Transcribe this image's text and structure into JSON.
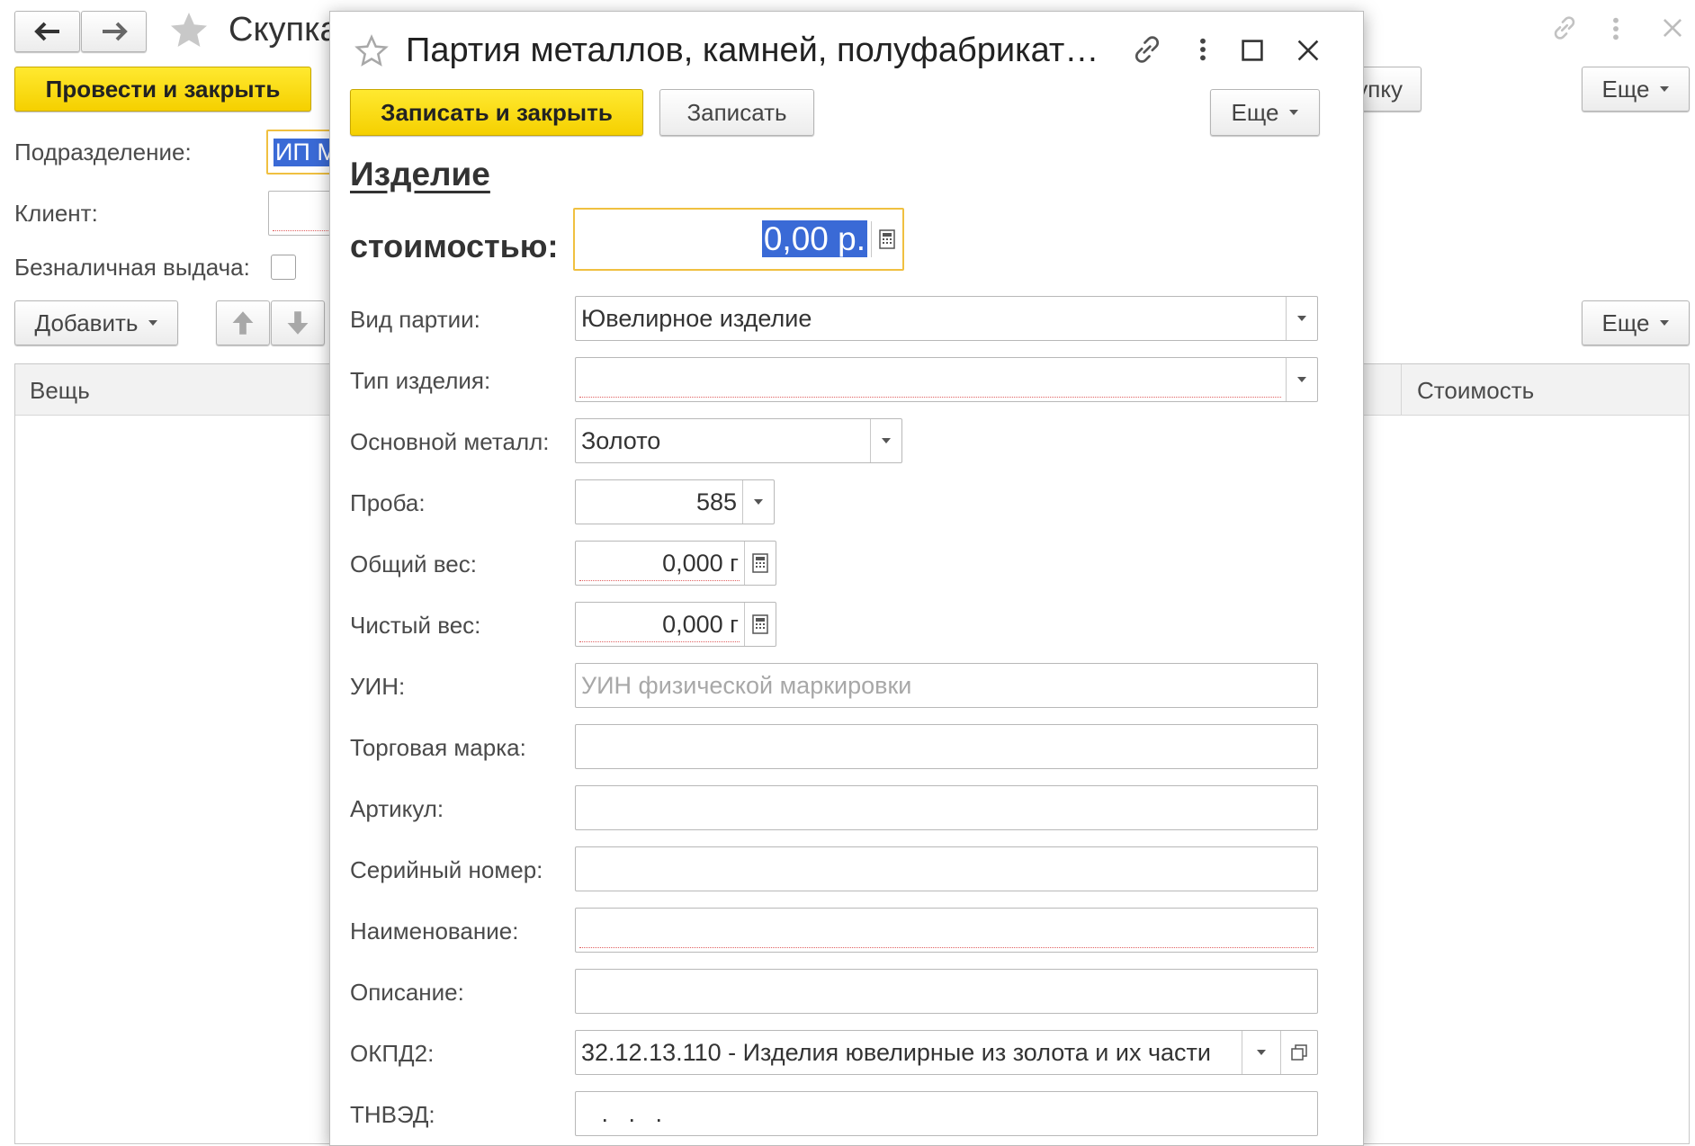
{
  "background": {
    "title": "Скупка",
    "post_close_label": "Провести и закрыть",
    "more_label": "Еще",
    "right_button_label": "упку",
    "fields": {
      "division_label": "Подразделение:",
      "division_value": "ИП М",
      "client_label": "Клиент:",
      "cashless_label": "Безналичная выдача:"
    },
    "add_label": "Добавить",
    "table_more_label": "Еще",
    "columns": {
      "item": "Вещь",
      "cost": "Стоимость"
    }
  },
  "modal": {
    "title": "Партия металлов, камней, полуфабрикат…",
    "save_close_label": "Записать и закрыть",
    "save_label": "Записать",
    "more_label": "Еще",
    "section_title": "Изделие",
    "cost_label": "стоимостью:",
    "cost_value": "0,00 р.",
    "rows": {
      "batch_type": {
        "label": "Вид партии:",
        "value": "Ювелирное изделие"
      },
      "item_type": {
        "label": "Тип изделия:",
        "value": ""
      },
      "main_metal": {
        "label": "Основной металл:",
        "value": "Золото"
      },
      "fineness": {
        "label": "Проба:",
        "value": "585"
      },
      "total_weight": {
        "label": "Общий вес:",
        "value": "0,000 г"
      },
      "net_weight": {
        "label": "Чистый вес:",
        "value": "0,000 г"
      },
      "uin": {
        "label": "УИН:",
        "placeholder": "УИН физической маркировки"
      },
      "trademark": {
        "label": "Торговая марка:",
        "value": ""
      },
      "article": {
        "label": "Артикул:",
        "value": ""
      },
      "serial": {
        "label": "Серийный номер:",
        "value": ""
      },
      "name": {
        "label": "Наименование:",
        "value": ""
      },
      "description": {
        "label": "Описание:",
        "value": ""
      },
      "okpd2": {
        "label": "ОКПД2:",
        "value": "32.12.13.110 - Изделия ювелирные из золота и их части"
      },
      "tnved": {
        "label": "ТНВЭД:",
        "value": "   .   .   ."
      }
    }
  },
  "colors": {
    "accent_yellow": "#f5d000",
    "selection_blue": "#3a6ad6",
    "focus_border": "#f0c040",
    "required_underline": "#e06060"
  }
}
